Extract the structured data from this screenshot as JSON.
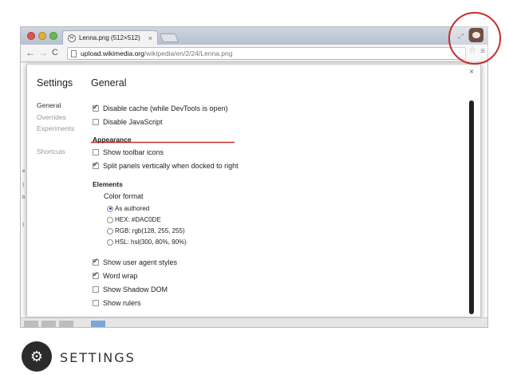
{
  "browser": {
    "tab_title": "Lenna.png (512×512)",
    "tab_close": "×",
    "url_host": "upload.wikimedia.org",
    "url_path": "/wikipedia/en/2/24/Lenna.png"
  },
  "dialog": {
    "close": "×",
    "title": "Settings",
    "pane_title": "General",
    "sidebar": [
      "General",
      "Overrides",
      "Experiments",
      "Shortcuts"
    ],
    "general_options": [
      {
        "label": "Disable cache (while DevTools is open)",
        "checked": true
      },
      {
        "label": "Disable JavaScript",
        "checked": false
      }
    ],
    "appearance": {
      "heading": "Appearance",
      "options": [
        {
          "label": "Show toolbar icons",
          "checked": false
        },
        {
          "label": "Split panels vertically when docked to right",
          "checked": true
        }
      ]
    },
    "elements": {
      "heading": "Elements",
      "color_format_label": "Color format",
      "color_formats": [
        {
          "label": "As authored",
          "selected": true
        },
        {
          "label": "HEX: #DAC0DE",
          "selected": false
        },
        {
          "label": "RGB: rgb(128, 255, 255)",
          "selected": false
        },
        {
          "label": "HSL: hsl(300, 80%, 90%)",
          "selected": false
        }
      ],
      "options": [
        {
          "label": "Show user agent styles",
          "checked": true
        },
        {
          "label": "Word wrap",
          "checked": true
        },
        {
          "label": "Show Shadow DOM",
          "checked": false
        },
        {
          "label": "Show rulers",
          "checked": false
        }
      ]
    }
  },
  "footer": {
    "icon": "gear-icon",
    "title": "SETTINGS"
  },
  "colors": {
    "highlight": "#c82c2c",
    "checkbox_accent": "#2a4d9b"
  }
}
